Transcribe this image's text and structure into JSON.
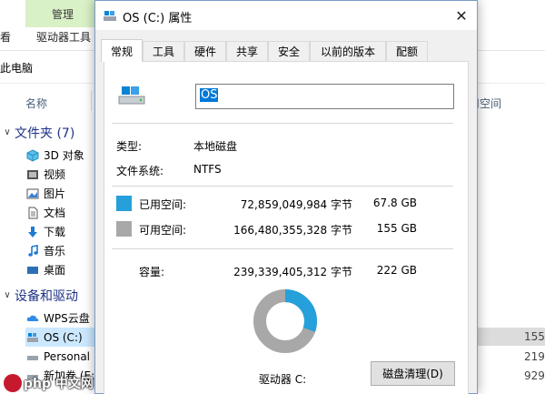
{
  "explorer": {
    "ribbon": {
      "manage_tab": "管理",
      "view_label": "看",
      "drive_tools": "驱动器工具"
    },
    "address": "此电脑",
    "columns": {
      "name": "名称",
      "free_space": "用空间"
    },
    "nav": {
      "folders_group": "文件夹 (7)",
      "items": [
        "3D 对象",
        "视频",
        "图片",
        "文档",
        "下载",
        "音乐",
        "桌面"
      ],
      "devices_group": "设备和驱动",
      "drives": [
        "WPS云盘",
        "OS (C:)",
        "Personal",
        "新加卷 (E:"
      ]
    },
    "right_values": [
      "155",
      "219",
      "929"
    ],
    "watermark": "php 中文网"
  },
  "dialog": {
    "title": "OS (C:) 属性",
    "close_glyph": "✕",
    "tabs": [
      "常规",
      "工具",
      "硬件",
      "共享",
      "安全",
      "以前的版本",
      "配额"
    ],
    "active_tab": 0,
    "drive_name": "OS",
    "type_label": "类型:",
    "type_value": "本地磁盘",
    "fs_label": "文件系统:",
    "fs_value": "NTFS",
    "used": {
      "label": "已用空间:",
      "bytes": "72,859,049,984 字节",
      "gb": "67.8 GB",
      "color": "#26a0da"
    },
    "free": {
      "label": "可用空间:",
      "bytes": "166,480,355,328 字节",
      "gb": "155 GB",
      "color": "#a8a8a8"
    },
    "capacity": {
      "label": "容量:",
      "bytes": "239,339,405,312 字节",
      "gb": "222 GB"
    },
    "used_fraction": 0.3044,
    "drive_caption": "驱动器 C:",
    "cleanup_button": "磁盘清理(D)"
  }
}
